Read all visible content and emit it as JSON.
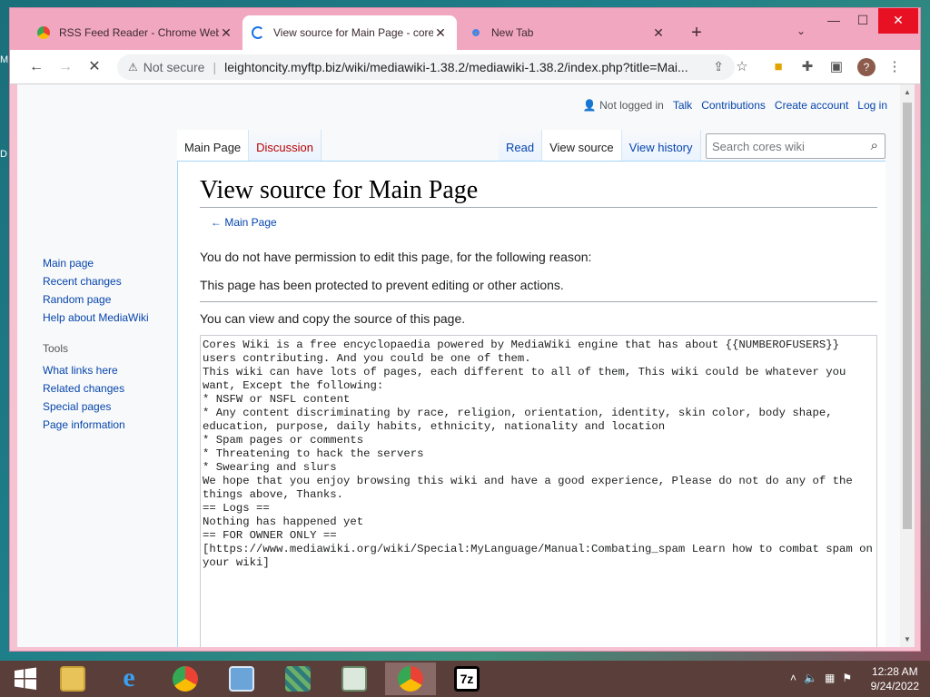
{
  "desktop": {
    "frag1": "M",
    "frag2": "D"
  },
  "browser": {
    "tabs": [
      {
        "label": "RSS Feed Reader - Chrome Web",
        "icon": "rss-favicon"
      },
      {
        "label": "View source for Main Page - core",
        "icon": "loading-spinner-icon"
      },
      {
        "label": "New Tab",
        "icon": "chrome-favicon"
      }
    ],
    "controls": {
      "minimize": "—",
      "maximize": "☐",
      "close": "✕",
      "new_tab": "+",
      "tab_list": "⌄"
    },
    "omnibox": {
      "security_label": "Not secure",
      "url": "leightoncity.myftp.biz/wiki/mediawiki-1.38.2/mediawiki-1.38.2/index.php?title=Mai..."
    },
    "profile_initial": "?"
  },
  "wiki": {
    "personal": {
      "status": "Not logged in",
      "links": [
        "Talk",
        "Contributions",
        "Create account",
        "Log in"
      ]
    },
    "namespaces": [
      {
        "label": "Main Page",
        "selected": true
      },
      {
        "label": "Discussion",
        "selected": false
      }
    ],
    "views": [
      {
        "label": "Read",
        "selected": false
      },
      {
        "label": "View source",
        "selected": true
      },
      {
        "label": "View history",
        "selected": false
      }
    ],
    "search_placeholder": "Search cores wiki",
    "sidebar": {
      "nav": [
        "Main page",
        "Recent changes",
        "Random page",
        "Help about MediaWiki"
      ],
      "tools_heading": "Tools",
      "tools": [
        "What links here",
        "Related changes",
        "Special pages",
        "Page information"
      ]
    },
    "title": "View source for Main Page",
    "backlink": "← Main Page",
    "permission_text": "You do not have permission to edit this page, for the following reason:",
    "protected_text": "This page has been protected to prevent editing or other actions.",
    "view_copy_text": "You can view and copy the source of this page.",
    "source": "Cores Wiki is a free encyclopaedia powered by MediaWiki engine that has about {{NUMBEROFUSERS}} users contributing. And you could be one of them.\nThis wiki can have lots of pages, each different to all of them, This wiki could be whatever you want, Except the following:\n* NSFW or NSFL content\n* Any content discriminating by race, religion, orientation, identity, skin color, body shape, education, purpose, daily habits, ethnicity, nationality and location\n* Spam pages or comments\n* Threatening to hack the servers\n* Swearing and slurs\nWe hope that you enjoy browsing this wiki and have a good experience, Please do not do any of the things above, Thanks.\n== Logs ==\nNothing has happened yet\n== FOR OWNER ONLY ==\n[https://www.mediawiki.org/wiki/Special:MyLanguage/Manual:Combating_spam Learn how to combat spam on your wiki]"
  },
  "taskbar": {
    "apps": [
      "windows-start",
      "file-explorer",
      "internet-explorer",
      "chrome",
      "control-panel",
      "network-app",
      "media-app",
      "chrome-active",
      "7zip"
    ],
    "time": "12:28 AM",
    "date": "9/24/2022"
  }
}
